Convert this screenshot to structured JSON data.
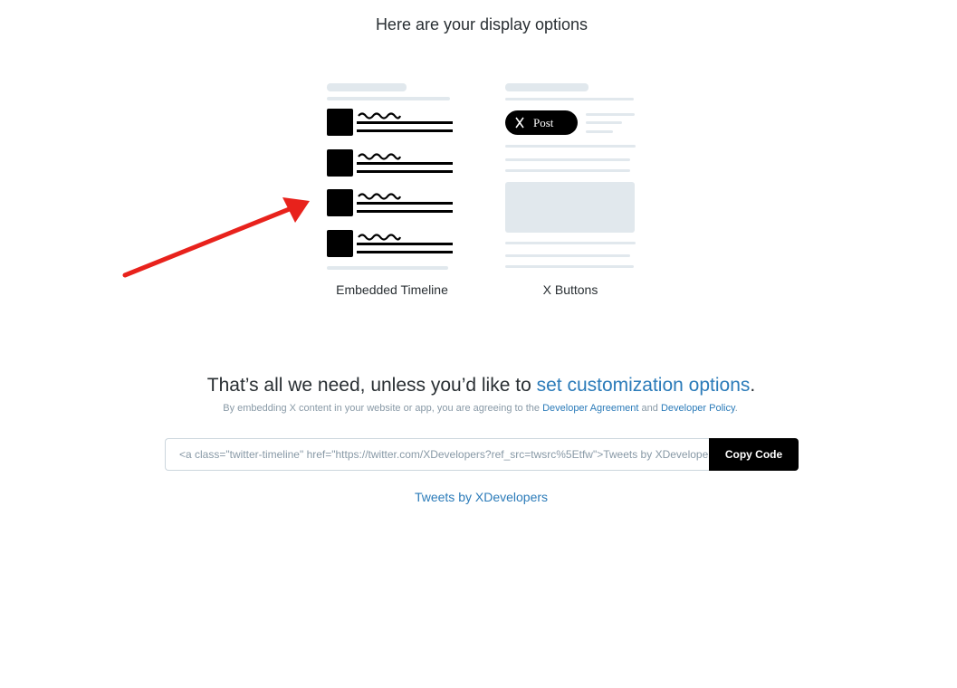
{
  "options": {
    "title": "Here are your display options",
    "items": [
      {
        "label": "Embedded Timeline"
      },
      {
        "label": "X Buttons",
        "post_button_label": "Post"
      }
    ]
  },
  "customize": {
    "headline_prefix": "That’s all we need, unless you’d like to ",
    "headline_link": "set customization options",
    "headline_suffix": "."
  },
  "agreement": {
    "prefix": "By embedding X content in your website or app, you are agreeing to the ",
    "link1": "Developer Agreement",
    "middle": " and ",
    "link2": "Developer Policy",
    "suffix": "."
  },
  "embed": {
    "code": "<a class=\"twitter-timeline\" href=\"https://twitter.com/XDevelopers?ref_src=twsrc%5Etfw\">Tweets by XDevelopers</a>",
    "copy_label": "Copy Code"
  },
  "preview": {
    "link_text": "Tweets by XDevelopers"
  },
  "colors": {
    "link": "#2b7bb9",
    "placeholder_gray": "#e1e8ed",
    "annotation_arrow": "#e8221c"
  }
}
